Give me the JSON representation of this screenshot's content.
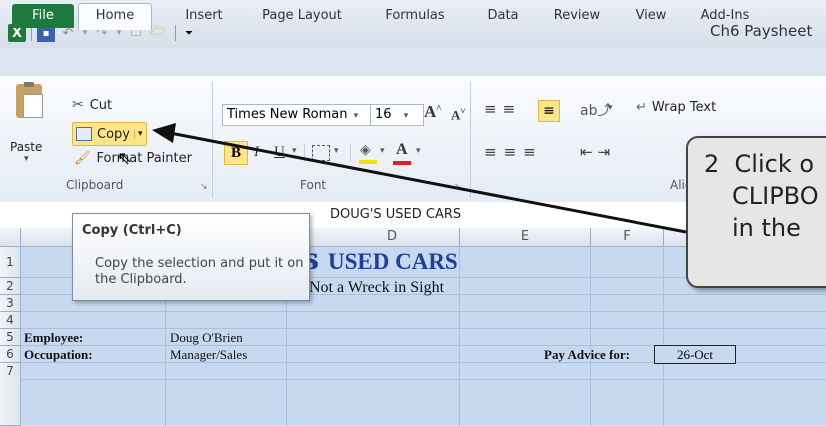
{
  "window": {
    "title": "Ch6 Paysheet"
  },
  "tabs": [
    "File",
    "Home",
    "Insert",
    "Page Layout",
    "Formulas",
    "Data",
    "Review",
    "View",
    "Add-Ins"
  ],
  "clipboard": {
    "paste": "Paste",
    "cut": "Cut",
    "copy": "Copy",
    "format_painter": "Format Painter",
    "group_label": "Clipboard"
  },
  "font": {
    "name": "Times New Roman",
    "size": "16",
    "bold": "B",
    "italic": "I",
    "underline": "U",
    "font_color_letter": "A",
    "grow": "A",
    "shrink": "A",
    "group_label": "Font"
  },
  "alignment": {
    "wrap_text": "Wrap Text",
    "group_label": "Alignment"
  },
  "formula_bar": {
    "content": "DOUG'S USED CARS"
  },
  "tooltip": {
    "title": "Copy (Ctrl+C)",
    "line1": "Copy the selection and put it on",
    "line2": "the Clipboard."
  },
  "callout": {
    "line1": "2  Click o",
    "line2": "CLIPBO",
    "line3": "in the"
  },
  "columns": [
    "D",
    "E",
    "F"
  ],
  "rows": [
    "1",
    "2",
    "3",
    "4",
    "5",
    "6",
    "7"
  ],
  "sheet": {
    "title": "USED CARS",
    "title_prefix": "S",
    "subtitle": "Not a Wreck in Sight",
    "employee_label": "Employee:",
    "employee_value": "Doug O'Brien",
    "occupation_label": "Occupation:",
    "occupation_value": "Manager/Sales",
    "pay_advice_label": "Pay Advice for:",
    "pay_advice_value": "26-Oct"
  },
  "colors": {
    "accent": "#1e7a3c",
    "sheet_blue": "#c6d9ef",
    "title_blue": "#1f3f9c",
    "copy_highlight": "#fde58a"
  }
}
